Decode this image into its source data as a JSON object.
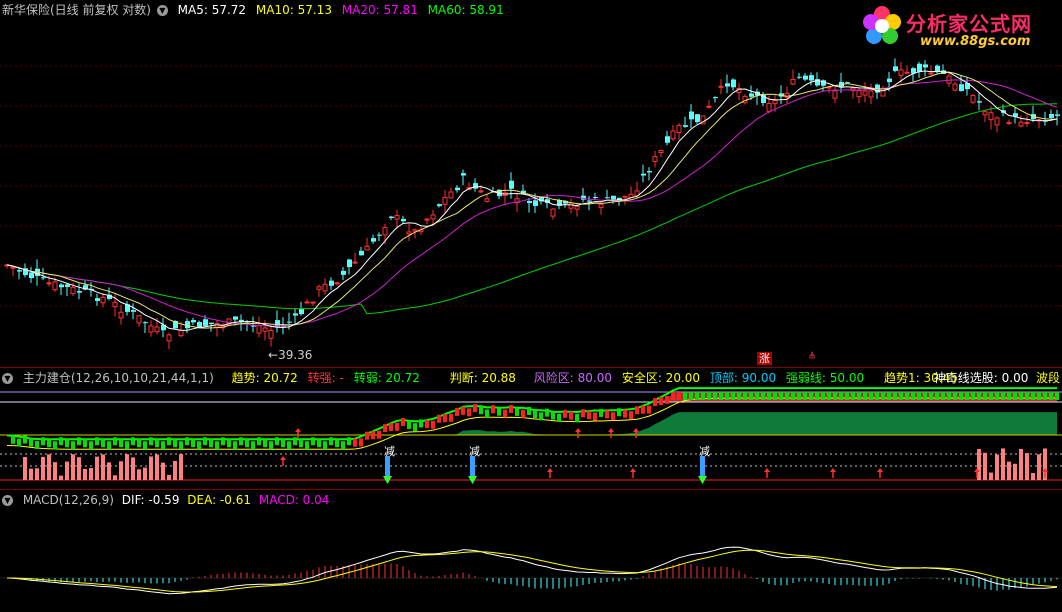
{
  "panel_main": {
    "title": "新华保险(日线 前复权 对数)",
    "ma": [
      {
        "label": "MA5: 57.72",
        "color": "#ffffff"
      },
      {
        "label": "MA10: 57.13",
        "color": "#ffff00"
      },
      {
        "label": "MA20: 57.81",
        "color": "#ff00ff"
      },
      {
        "label": "MA60: 58.91",
        "color": "#00ff00"
      }
    ],
    "low_label": "39.36",
    "marker_zhang": "涨",
    "marker_small": "≜"
  },
  "panel_ind": {
    "title": "主力建仓(12,26,10,10,21,44,1,1)",
    "items": [
      {
        "label": "趋势: 20.72",
        "color": "#ffff00"
      },
      {
        "label": "转强: -",
        "color": "#ff3333"
      },
      {
        "label": "转弱: 20.72",
        "color": "#00ff00"
      },
      {
        "label": "判断: 20.88",
        "color": "#ffff00"
      },
      {
        "label": "风险区: 80.00",
        "color": "#cc66ff"
      },
      {
        "label": "安全区: 20.00",
        "color": "#ffff00"
      },
      {
        "label": "顶部: 90.00",
        "color": "#00ccff"
      },
      {
        "label": "强弱线: 50.00",
        "color": "#00ff00"
      },
      {
        "label": "趋势1: 30.45",
        "color": "#ffff00"
      }
    ],
    "right_label": "神奇线选股: 0.00",
    "right_tail": "波段",
    "reduce_label": "减"
  },
  "panel_macd": {
    "title": "MACD(12,26,9)",
    "dif": "DIF: -0.59",
    "dea": "DEA: -0.61",
    "macd": "MACD: 0.04"
  },
  "logo": {
    "name": "分析家公式网",
    "url": "www.88gs.com"
  },
  "chart_data": {
    "type": "candlestick",
    "ma_series": [
      "MA5",
      "MA10",
      "MA20",
      "MA60"
    ],
    "visible_low": 39.36,
    "note_last_values": {
      "MA5": 57.72,
      "MA10": 57.13,
      "MA20": 57.81,
      "MA60": 58.91,
      "DIF": -0.59,
      "DEA": -0.61,
      "MACD": 0.04
    }
  }
}
